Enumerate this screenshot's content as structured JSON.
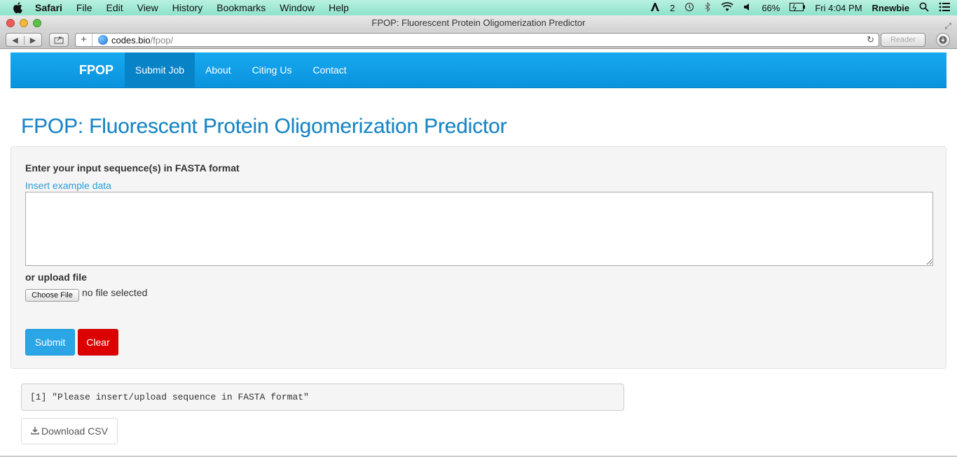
{
  "menubar": {
    "app": "Safari",
    "items": [
      "File",
      "Edit",
      "View",
      "History",
      "Bookmarks",
      "Window",
      "Help"
    ],
    "status": {
      "adobe_count": "2",
      "battery": "66%",
      "clock": "Fri 4:04 PM",
      "user": "Rnewbie"
    }
  },
  "window": {
    "title": "FPOP: Fluorescent Protein Oligomerization Predictor",
    "address_host": "codes.bio",
    "address_path": "/fpop/",
    "reader_label": "Reader"
  },
  "nav": {
    "brand": "FPOP",
    "links": [
      "Submit Job",
      "About",
      "Citing Us",
      "Contact"
    ],
    "active": "Submit Job"
  },
  "page": {
    "title": "FPOP: Fluorescent Protein Oligomerization Predictor",
    "input_label": "Enter your input sequence(s) in FASTA format",
    "example_link": "Insert example data",
    "sequence_value": "",
    "upload_label": "or upload file",
    "choose_file_label": "Choose File",
    "no_file_text": "no file selected",
    "submit_label": "Submit",
    "clear_label": "Clear",
    "output_text": "[1] \"Please insert/upload sequence in FASTA format\"",
    "download_label": "Download CSV"
  },
  "colors": {
    "navbar": "#0a93dd",
    "title": "#1a86c4",
    "submit": "#2aa6e6",
    "clear": "#dd0000"
  }
}
